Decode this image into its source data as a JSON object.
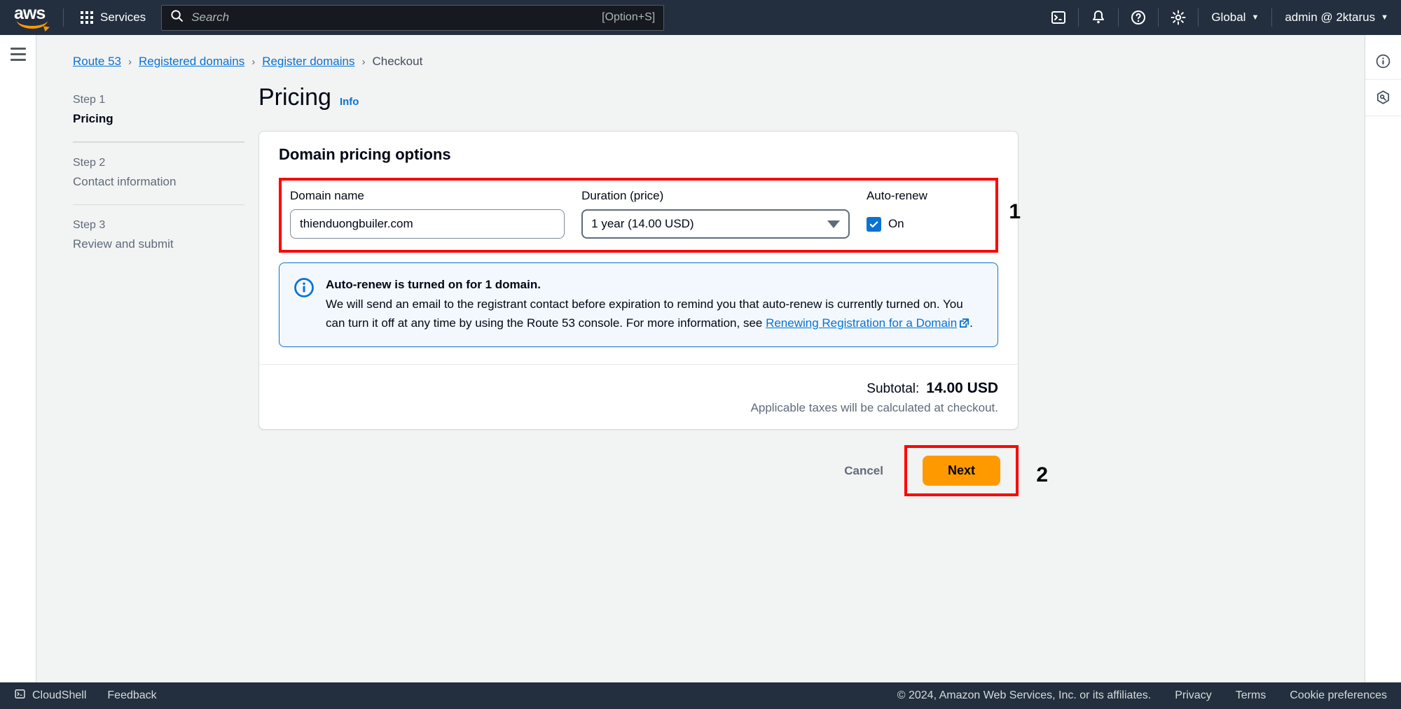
{
  "topnav": {
    "logo_text": "aws",
    "services_label": "Services",
    "search": {
      "placeholder": "Search",
      "shortcut": "[Option+S]",
      "icon": "search-icon"
    },
    "icons": [
      "cloudshell-icon",
      "bell-icon",
      "help-icon",
      "settings-icon"
    ],
    "region_label": "Global",
    "account_label": "admin @ 2ktarus",
    "caret": "▼"
  },
  "breadcrumb": {
    "items": [
      {
        "label": "Route 53",
        "link": true
      },
      {
        "label": "Registered domains",
        "link": true
      },
      {
        "label": "Register domains",
        "link": true
      },
      {
        "label": "Checkout",
        "link": false
      }
    ],
    "separator": "›"
  },
  "steps": [
    {
      "num": "Step 1",
      "name": "Pricing",
      "active": true
    },
    {
      "num": "Step 2",
      "name": "Contact information",
      "active": false
    },
    {
      "num": "Step 3",
      "name": "Review and submit",
      "active": false
    }
  ],
  "page": {
    "title": "Pricing",
    "info_label": "Info"
  },
  "container": {
    "title": "Domain pricing options",
    "fields": {
      "domain_name_label": "Domain name",
      "domain_name_value": "thienduongbuiler.com",
      "duration_label": "Duration (price)",
      "duration_value": "1 year (14.00 USD)",
      "autorenew_label": "Auto-renew",
      "autorenew_state": "On",
      "autorenew_checked": true
    },
    "alert": {
      "icon": "info-circle-icon",
      "title": "Auto-renew is turned on for 1 domain.",
      "body_part1": "We will send an email to the registrant contact before expiration to remind you that auto-renew is currently turned on. You can turn it off at any time by using the Route 53 console. For more information, see ",
      "link_text": "Renewing Registration for a Domain",
      "link_icon": "external-link-icon",
      "body_part2": "."
    },
    "subtotal_label": "Subtotal:",
    "subtotal_value": "14.00 USD",
    "tax_note": "Applicable taxes will be calculated at checkout."
  },
  "actions": {
    "cancel_label": "Cancel",
    "next_label": "Next"
  },
  "annotations": {
    "marker_one": "1",
    "marker_two": "2",
    "color": "#ff0000"
  },
  "rightrail": {
    "icons": [
      "info-panel-icon",
      "support-panel-icon"
    ]
  },
  "footer": {
    "cloudshell_label": "CloudShell",
    "cloudshell_icon": "cloudshell-icon",
    "feedback_label": "Feedback",
    "copyright": "© 2024, Amazon Web Services, Inc. or its affiliates.",
    "links": [
      "Privacy",
      "Terms",
      "Cookie preferences"
    ]
  },
  "colors": {
    "nav_bg": "#232f3e",
    "accent_link": "#0972d3",
    "button_primary": "#ff9900",
    "annotation": "#ff0000"
  }
}
